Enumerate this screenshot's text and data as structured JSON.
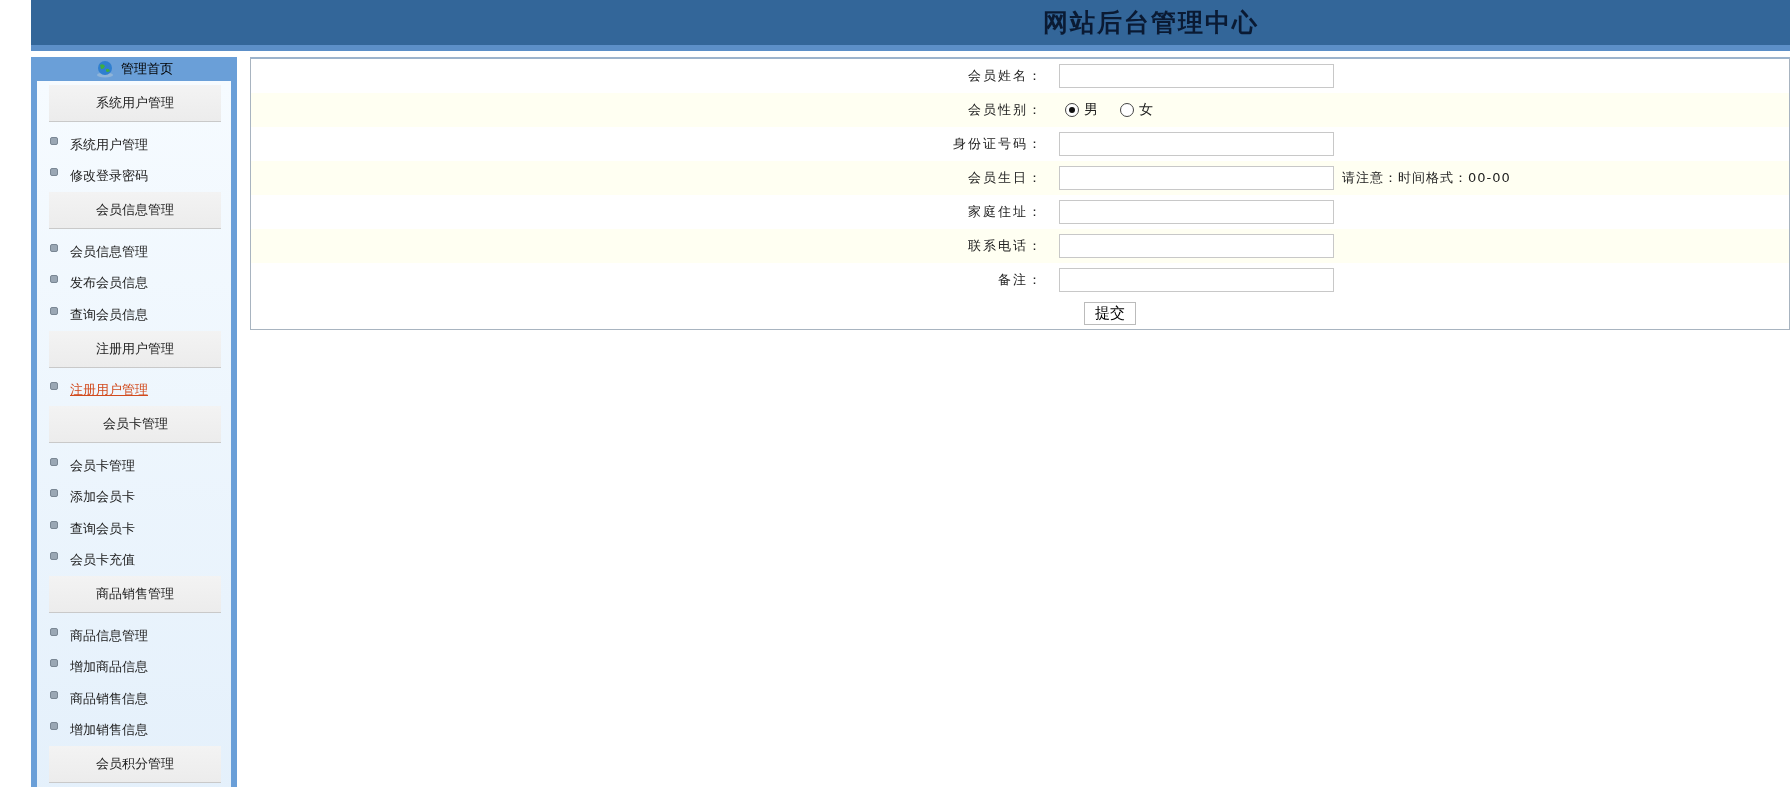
{
  "header": {
    "title": "网站后台管理中心"
  },
  "sidebar": {
    "title": "管理首页",
    "groups": [
      {
        "heading": "系统用户管理",
        "items": [
          {
            "label": "系统用户管理",
            "selected": false
          },
          {
            "label": "修改登录密码",
            "selected": false
          }
        ]
      },
      {
        "heading": "会员信息管理",
        "items": [
          {
            "label": "会员信息管理",
            "selected": false
          },
          {
            "label": "发布会员信息",
            "selected": false
          },
          {
            "label": "查询会员信息",
            "selected": false
          }
        ]
      },
      {
        "heading": "注册用户管理",
        "items": [
          {
            "label": "注册用户管理",
            "selected": true
          }
        ]
      },
      {
        "heading": "会员卡管理",
        "items": [
          {
            "label": "会员卡管理",
            "selected": false
          },
          {
            "label": "添加会员卡",
            "selected": false
          },
          {
            "label": "查询会员卡",
            "selected": false
          },
          {
            "label": "会员卡充值",
            "selected": false
          }
        ]
      },
      {
        "heading": "商品销售管理",
        "items": [
          {
            "label": "商品信息管理",
            "selected": false
          },
          {
            "label": "增加商品信息",
            "selected": false
          },
          {
            "label": "商品销售信息",
            "selected": false
          },
          {
            "label": "增加销售信息",
            "selected": false
          }
        ]
      },
      {
        "heading": "会员积分管理"
      }
    ]
  },
  "form": {
    "fields": [
      {
        "kind": "text",
        "label": "会员姓名："
      },
      {
        "kind": "radio",
        "label": "会员性别：",
        "options": [
          {
            "label": "男",
            "selected": true
          },
          {
            "label": "女",
            "selected": false
          }
        ]
      },
      {
        "kind": "text",
        "label": "身份证号码："
      },
      {
        "kind": "text",
        "label": "会员生日：",
        "hint": "请注意：时间格式：00-00"
      },
      {
        "kind": "text",
        "label": "家庭住址："
      },
      {
        "kind": "text",
        "label": "联系电话："
      },
      {
        "kind": "text",
        "label": "备注："
      }
    ],
    "submit": "提交"
  }
}
